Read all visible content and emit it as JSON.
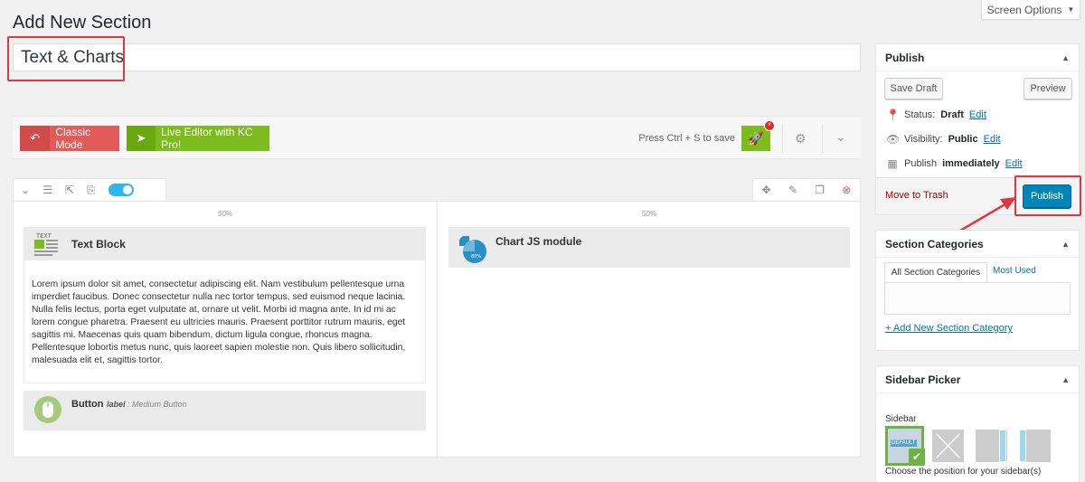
{
  "page": {
    "title": "Add New Section",
    "screen_options": "Screen Options"
  },
  "post": {
    "title_value": "Text & Charts"
  },
  "kc": {
    "classic_label": "Classic Mode",
    "live_label": "Live Editor with KC Pro!",
    "save_hint": "Press Ctrl + S to save",
    "save_badge": "*"
  },
  "builder": {
    "col_left_width": "50%",
    "col_right_width": "50%",
    "text_block": {
      "icon_text": "TEXT",
      "title": "Text Block",
      "content": "Lorem ipsum dolor sit amet, consectetur adipiscing elit. Nam vestibulum pellentesque urna imperdiet faucibus. Donec consectetur nulla nec tortor tempus, sed euismod neque lacinia. Nulla felis lectus, porta eget vulputate at, ornare ut velit. Morbi id magna ante. In id mi ac lorem congue pharetra. Praesent eu ultricies mauris. Praesent porttitor rutrum mauris, eget sagittis mi. Maecenas quis quam bibendum, dictum ligula congue, rhoncus magna. Pellentesque lobortis metus nunc, quis laoreet sapien molestie non. Quis libero sollicitudin, malesuada elit et, sagittis tortor."
    },
    "button_el": {
      "title": "Button",
      "meta_key": "label",
      "meta_value": " : Medium Button"
    },
    "chart_el": {
      "title": "Chart JS module",
      "icon_text": "80%"
    }
  },
  "publish": {
    "title": "Publish",
    "save_draft": "Save Draft",
    "preview": "Preview",
    "status_label": "Status:",
    "status_value": "Draft",
    "visibility_label": "Visibility:",
    "visibility_value": "Public",
    "publish_label": "Publish",
    "publish_value": "immediately",
    "edit": "Edit",
    "move_trash": "Move to Trash",
    "publish_button": "Publish"
  },
  "categories": {
    "title": "Section Categories",
    "tab_all": "All Section Categories",
    "tab_used": "Most Used",
    "add_new": "+ Add New Section Category"
  },
  "sidebar_picker": {
    "title": "Sidebar Picker",
    "label": "Sidebar",
    "default_label": "DEFAULT",
    "hint": "Choose the position for your sidebar(s)"
  },
  "colors": {
    "accent_red": "#e0383e",
    "kc_green": "#7cbc1e",
    "publish_blue": "#0085ba"
  }
}
